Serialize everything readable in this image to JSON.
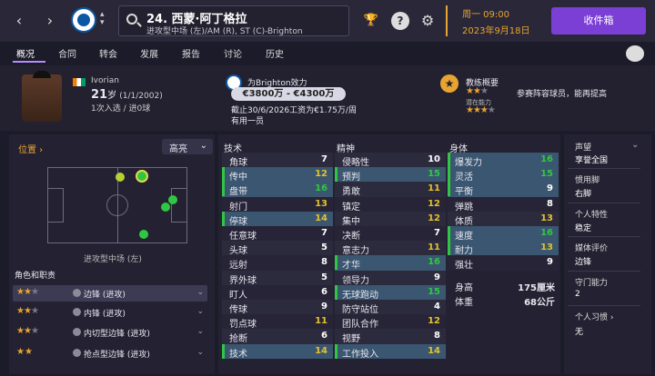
{
  "header": {
    "title": "24. 西蒙·阿丁格拉",
    "subtitle": "进攻型中场 (左)/AM (R), ST (C)-Brighton",
    "date_day": "周一 09:00",
    "date": "2023年9月18日",
    "inbox": "收件箱",
    "back_glyph": "‹",
    "forward_glyph": "›"
  },
  "colors": {
    "accent": "#7b3fd6",
    "orange": "#e8a432",
    "green": "#2fc742",
    "yellow": "#e2c22c"
  },
  "menu": [
    "概况",
    "合同",
    "转会",
    "发展",
    "报告",
    "讨论",
    "历史"
  ],
  "player": {
    "nation": "Ivorian",
    "age": "21",
    "age_unit": "岁",
    "dob": "(1/1/2002)",
    "caps": "1次入选 / 进0球",
    "club_label": "为Brighton效力",
    "value": "€3800万 - €4300万",
    "contract": "截止30/6/2026工资为€1.75万/周",
    "squad": "有用一员"
  },
  "coach": {
    "title": "教练概要",
    "rating_current": 2.5,
    "summary": "参赛阵容球员，能再提高",
    "potential_label": "潜在能力",
    "rating_potential": 3.5
  },
  "position": {
    "title": "位置",
    "dropdown": "高亮",
    "pos_label": "进攻型中场 (左)"
  },
  "roles": {
    "title": "角色和职责",
    "items": [
      {
        "label": "边锋 (进攻)",
        "stars": 2.5
      },
      {
        "label": "内锋 (进攻)",
        "stars": 2.5
      },
      {
        "label": "内切型边锋 (进攻)",
        "stars": 2.5
      },
      {
        "label": "抢点型边锋 (进攻)",
        "stars": 2.0
      }
    ]
  },
  "tech": {
    "title": "技术",
    "rows": [
      [
        "角球",
        "7"
      ],
      [
        "传中",
        "12"
      ],
      [
        "盘带",
        "16"
      ],
      [
        "射门",
        "13"
      ],
      [
        "停球",
        "14"
      ],
      [
        "任意球",
        "7"
      ],
      [
        "头球",
        "5"
      ],
      [
        "远射",
        "8"
      ],
      [
        "界外球",
        "5"
      ],
      [
        "盯人",
        "6"
      ],
      [
        "传球",
        "9"
      ],
      [
        "罚点球",
        "11"
      ],
      [
        "抢断",
        "6"
      ],
      [
        "技术",
        "14"
      ]
    ]
  },
  "mental": {
    "title": "精神",
    "rows": [
      [
        "侵略性",
        "10"
      ],
      [
        "预判",
        "15"
      ],
      [
        "勇敢",
        "11"
      ],
      [
        "镇定",
        "12"
      ],
      [
        "集中",
        "12"
      ],
      [
        "决断",
        "7"
      ],
      [
        "意志力",
        "11"
      ],
      [
        "才华",
        "16"
      ],
      [
        "领导力",
        "9"
      ],
      [
        "无球跑动",
        "15"
      ],
      [
        "防守站位",
        "4"
      ],
      [
        "团队合作",
        "12"
      ],
      [
        "视野",
        "8"
      ],
      [
        "工作投入",
        "14"
      ]
    ]
  },
  "physical": {
    "title": "身体",
    "rows": [
      [
        "爆发力",
        "16"
      ],
      [
        "灵活",
        "15"
      ],
      [
        "平衡",
        "9"
      ],
      [
        "弹跳",
        "8"
      ],
      [
        "体质",
        "13"
      ],
      [
        "速度",
        "16"
      ],
      [
        "耐力",
        "13"
      ],
      [
        "强壮",
        "9"
      ]
    ],
    "height_label": "身高",
    "height": "175厘米",
    "weight_label": "体重",
    "weight": "68公斤"
  },
  "right": [
    {
      "label": "声望",
      "value": "享誉全国"
    },
    {
      "label": "惯用脚",
      "value": "右脚"
    },
    {
      "label": "个人特性",
      "value": "稳定"
    },
    {
      "label": "媒体评价",
      "value": "边锋"
    },
    {
      "label": "守门能力",
      "value": "2"
    },
    {
      "label": "个人习惯",
      "value": "无"
    }
  ]
}
